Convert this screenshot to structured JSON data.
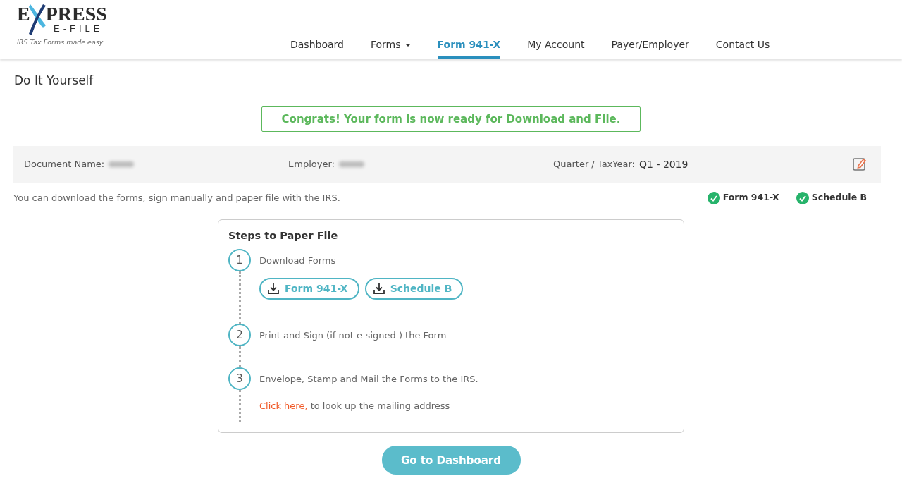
{
  "logo": {
    "letter": "E",
    "word": "PRESS",
    "sub": "E-FILE",
    "tagline": "IRS Tax Forms made easy"
  },
  "nav": [
    {
      "label": "Dashboard",
      "selected": false,
      "dropdown": false
    },
    {
      "label": "Forms",
      "selected": false,
      "dropdown": true
    },
    {
      "label": "Form 941-X",
      "selected": true,
      "dropdown": false
    },
    {
      "label": "My Account",
      "selected": false,
      "dropdown": false
    },
    {
      "label": "Payer/Employer",
      "selected": false,
      "dropdown": false
    },
    {
      "label": "Contact Us",
      "selected": false,
      "dropdown": false
    }
  ],
  "page_title": "Do It Yourself",
  "alert": "Congrats! Your form is now ready for Download and File.",
  "details": [
    {
      "label": "Document Name:",
      "redacted": true
    },
    {
      "label": "Employer:",
      "redacted": true
    },
    {
      "label": "Quarter / TaxYear:",
      "value": "Q1 - 2019",
      "redacted": false
    }
  ],
  "info_text": "You can download the forms, sign manually and paper file with the IRS.",
  "statuses": [
    {
      "label": "Form 941-X",
      "done": true
    },
    {
      "label": "Schedule B",
      "done": true
    }
  ],
  "steps_card": {
    "title": "Steps to Paper File",
    "steps": [
      {
        "number": "1",
        "text": "Download Forms",
        "buttons": [
          "Form 941-X",
          "Schedule B"
        ]
      },
      {
        "number": "2",
        "text": "Print and Sign (if not e-signed ) the Form"
      },
      {
        "number": "3",
        "text": "Envelope, Stamp and Mail the Forms to the IRS.",
        "link": "Click here,",
        "link_suffix": "to look up the mailing address"
      }
    ]
  },
  "primary_button": "Go to Dashboard"
}
